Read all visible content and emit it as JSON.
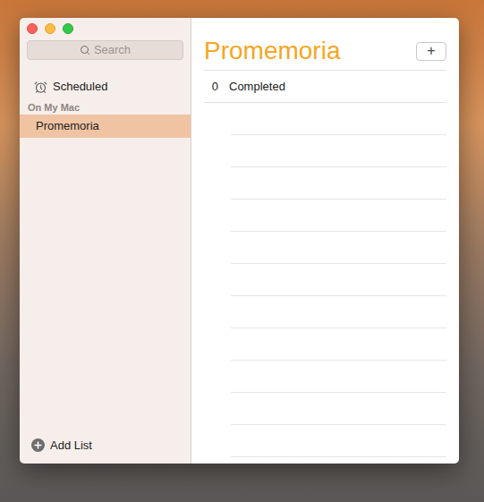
{
  "sidebar": {
    "search": {
      "placeholder": "Search"
    },
    "items": [
      {
        "label": "Scheduled",
        "selected": false
      }
    ],
    "section": "On My Mac",
    "lists": [
      {
        "label": "Promemoria",
        "selected": true
      }
    ],
    "add_button": "Add List"
  },
  "main": {
    "title": "Promemoria",
    "add_button": "+",
    "completed": {
      "count": "0",
      "label": "Completed"
    }
  }
}
